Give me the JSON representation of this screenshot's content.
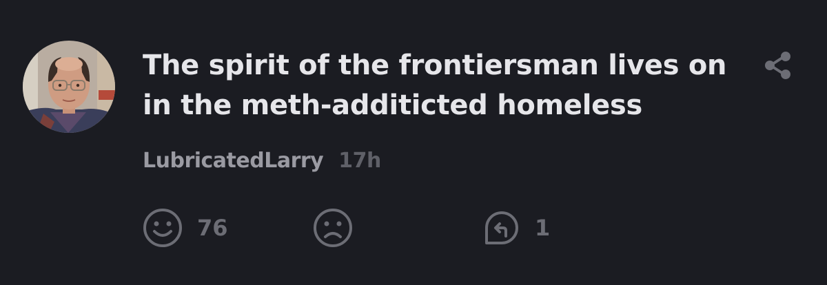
{
  "comment": {
    "text": "The spirit of the frontiersman lives on in the meth-additicted homeless",
    "author": "LubricatedLarry",
    "timestamp": "17h"
  },
  "actions": {
    "like_count": "76",
    "reply_count": "1"
  },
  "icons": {
    "share": "share-icon",
    "like": "smiley-face-icon",
    "dislike": "sad-face-icon",
    "reply": "reply-arrow-icon"
  },
  "colors": {
    "background": "#1b1c22",
    "text": "#e6e6ea",
    "username": "#9a9aa2",
    "timestamp": "#5f6068",
    "icon": "#6c6d75"
  }
}
